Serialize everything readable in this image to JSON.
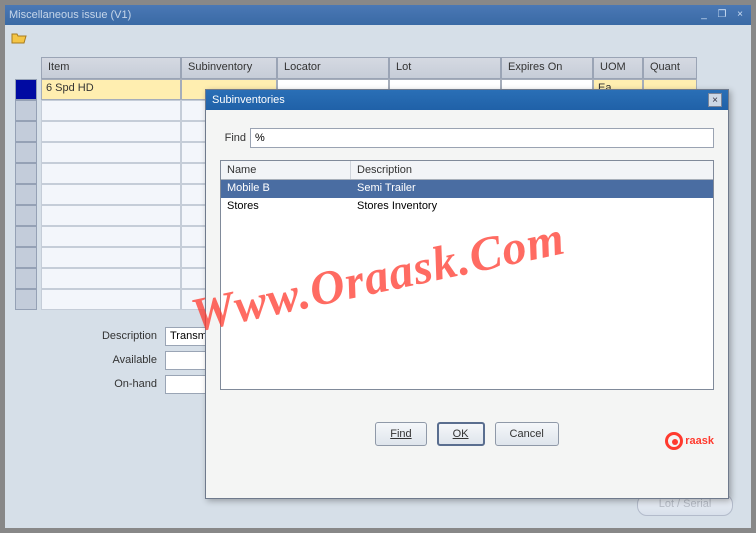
{
  "window": {
    "title": "Miscellaneous issue (V1)",
    "minimize_tip": "Minimize",
    "restore_tip": "Restore",
    "close_tip": "Close"
  },
  "columns": {
    "item": "Item",
    "subinventory": "Subinventory",
    "locator": "Locator",
    "lot": "Lot",
    "expires_on": "Expires On",
    "uom": "UOM",
    "quant": "Quant"
  },
  "rows": [
    {
      "item": "6 Spd HD",
      "subinventory": "",
      "locator": "",
      "lot": "",
      "expires_on": "",
      "uom": "Ea",
      "quant": ""
    }
  ],
  "labels": {
    "description": "Description",
    "available": "Available",
    "on_hand": "On-hand",
    "description_value": "Transmis"
  },
  "bottom_button": "Lot / Serial",
  "dialog": {
    "title": "Subinventories",
    "find_label": "Find",
    "find_value": "%",
    "col_name": "Name",
    "col_description": "Description",
    "items": [
      {
        "name": "Mobile B",
        "description": "Semi Trailer"
      },
      {
        "name": "Stores",
        "description": "Stores Inventory"
      }
    ],
    "btn_find": "Find",
    "btn_ok": "OK",
    "btn_cancel": "Cancel"
  },
  "watermark": {
    "center": "Www.Oraask.Com",
    "brand": "raask"
  }
}
